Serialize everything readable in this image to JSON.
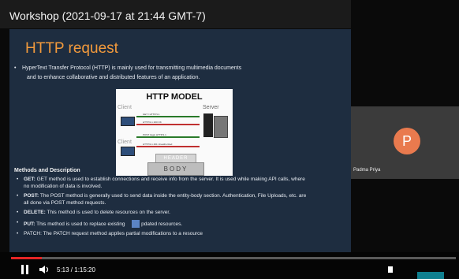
{
  "video": {
    "title": "Workshop (2021-09-17 at 21:44 GMT-7)"
  },
  "slide": {
    "heading": "HTTP request",
    "intro_line1": "HyperText Transfer Protocol (HTTP) is mainly used for transmitting multimedia documents",
    "intro_line2": "and to enhance collaborative and distributed features of an application.",
    "diagram": {
      "title": "HTTP MODEL",
      "client_label": "Client",
      "server_label": "Server",
      "header_label": "HEADER",
      "body_label": "BODY",
      "arrows": [
        "GET / HTTP/1.1",
        "HTTP/1.1 200 OK",
        "POST /login HTTP/1.1",
        "HTTP/1.1 401 Unauthorized"
      ]
    },
    "methods_heading": "Methods and Description",
    "methods": [
      {
        "name": "GET:",
        "text": "GET method is used to establish connections and receive info from the server. It is used while making API calls, where",
        "cont": "no modification of data is involved."
      },
      {
        "name": "POST:",
        "text": "The POST method is generally used to send data inside the entity-body section. Authentication, File Uploads, etc. are",
        "cont": "all done via POST method requests."
      },
      {
        "name": "DELETE:",
        "text": "This method is used to delete resources on the server."
      },
      {
        "name": "PUT:",
        "text_before": "This method is used to replace existing",
        "text_after": "pdated resources."
      },
      {
        "name": "PATCH:",
        "text": "The PATCH request method applies partial modifications to a resource"
      }
    ]
  },
  "participant": {
    "initial": "P",
    "name": "Padma Priya",
    "avatar_color": "#e97a4e"
  },
  "player": {
    "time": "5:13 / 1:15:20",
    "progress_fraction": 0.069,
    "progress_color": "#e52525"
  },
  "icons": [
    "play-pause-icon",
    "volume-icon",
    "captions-icon"
  ]
}
